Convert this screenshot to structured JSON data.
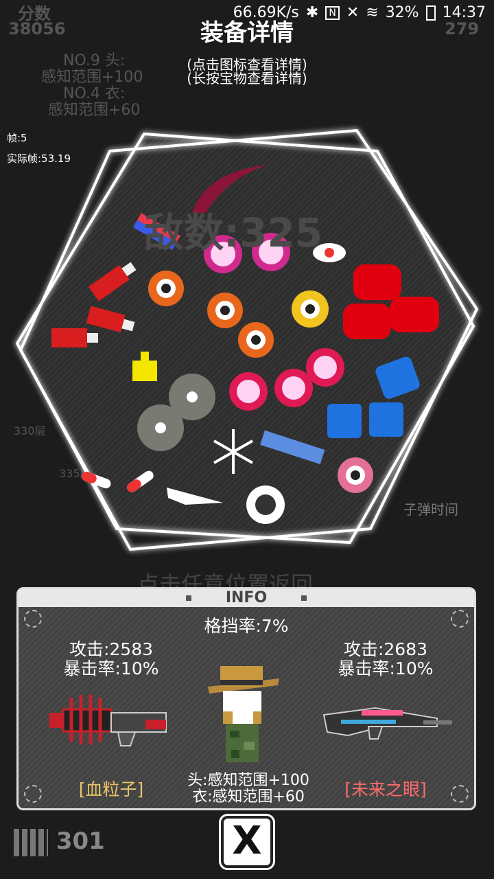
{
  "status_bar": {
    "speed": "66.69K/s",
    "battery": "32%",
    "time": "14:37"
  },
  "background": {
    "score_label": "分数",
    "score_value": "38056",
    "right_value": "279",
    "item1_title": "NO.9 头:",
    "item1_effect": "感知范围+100",
    "item2_title": "NO.4 衣:",
    "item2_effect": "感知范围+60",
    "tap_return": "点击任意位置返回",
    "bullet_time": "子弹时间",
    "floor_330": "330层",
    "floor_335": "335层",
    "ammo": "301",
    "enemy_count": "敌数:325"
  },
  "title": "装备详情",
  "hint_tap": "(点击图标查看详情)",
  "hint_hold": "(长按宝物查看详情)",
  "debug": {
    "frame": "帧:5",
    "real_frame": "实际帧:53.19"
  },
  "info": {
    "header": "INFO",
    "block_rate": "格挡率:7%",
    "left_weapon": {
      "attack": "攻击:2583",
      "crit": "暴击率:10%",
      "name": "[血粒子]",
      "icon": "red-heavy-gun-icon"
    },
    "right_weapon": {
      "attack": "攻击:2683",
      "crit": "暴击率:10%",
      "name": "[未来之眼]",
      "icon": "blue-sniper-rifle-icon"
    },
    "head_bonus": "头:感知范围+100",
    "body_bonus": "衣:感知范围+60",
    "character_icon": "character-safari-hat-icon"
  },
  "close_button": "X",
  "colors": {
    "panel_border": "#dddddd",
    "left_name": "#e9c46a",
    "right_name": "#ff6b6b"
  }
}
